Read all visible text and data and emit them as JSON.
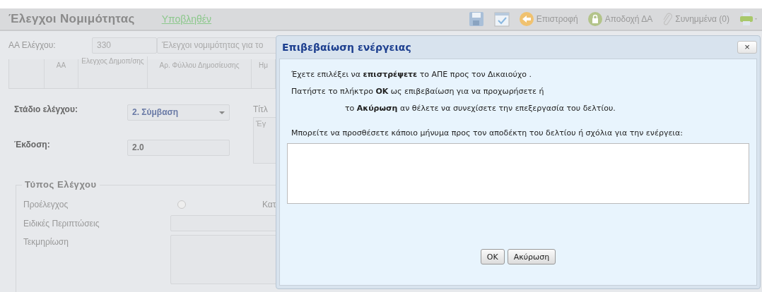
{
  "header": {
    "title": "Έλεγχοι Νομιμότητας",
    "status": "Υποβληθέν"
  },
  "toolbar": [
    {
      "kind": "save"
    },
    {
      "kind": "calendar"
    },
    {
      "kind": "back",
      "label": "Επιστροφή"
    },
    {
      "kind": "lock",
      "label": "Αποδοχή ΔΑ"
    },
    {
      "kind": "attach",
      "label": "Συνημμένα (0)"
    },
    {
      "kind": "print"
    }
  ],
  "check_row": {
    "label": "ΑΑ Ελέγχου:",
    "number": "330",
    "description": "Έλεγχοι νομιμότητας για το"
  },
  "table": {
    "columns": [
      "",
      "ΑΑ",
      "Ελεγχος Δημοπ/σης",
      "Αρ. Φύλλου Δημοσίευσης",
      "Ημ"
    ]
  },
  "form": {
    "stage_label": "Στάδιο ελέγχου:",
    "stage_value": "2. Σύμβαση",
    "title_label": "Τίτλ",
    "title_value": "Έγ",
    "version_label": "Έκδοση:",
    "version_value": "2.0"
  },
  "fieldset": {
    "legend": "Τύπος Ελέγχου",
    "precheck_label": "Προέλεγχος",
    "precheck_checked": false,
    "column_3": "Κατ",
    "special_label": "Ειδικές Περιπτώσεις",
    "evidence_label": "Τεκμηρίωση"
  },
  "dialog": {
    "title": "Επιβεβαίωση ενέργειας",
    "close": "×",
    "messages": [
      "Έχετε επιλέξει να **επιστρέψετε** το ΑΠΕ προς τον Δικαιούχο .",
      "Πατήστε το πλήκτρο **OK** ως επιβεβαίωση για να προχωρήσετε ή",
      "το  **Ακύρωση** αν θέλετε να συνεχίσετε την επεξεργασία του δελτίου."
    ],
    "prompt": "Μπορείτε να προσθέσετε κάποιο μήνυμα προς τον αποδέκτη του δελτίου ή σχόλια για την ενέργεια:",
    "buttons": [
      "OK",
      "Ακύρωση"
    ]
  }
}
